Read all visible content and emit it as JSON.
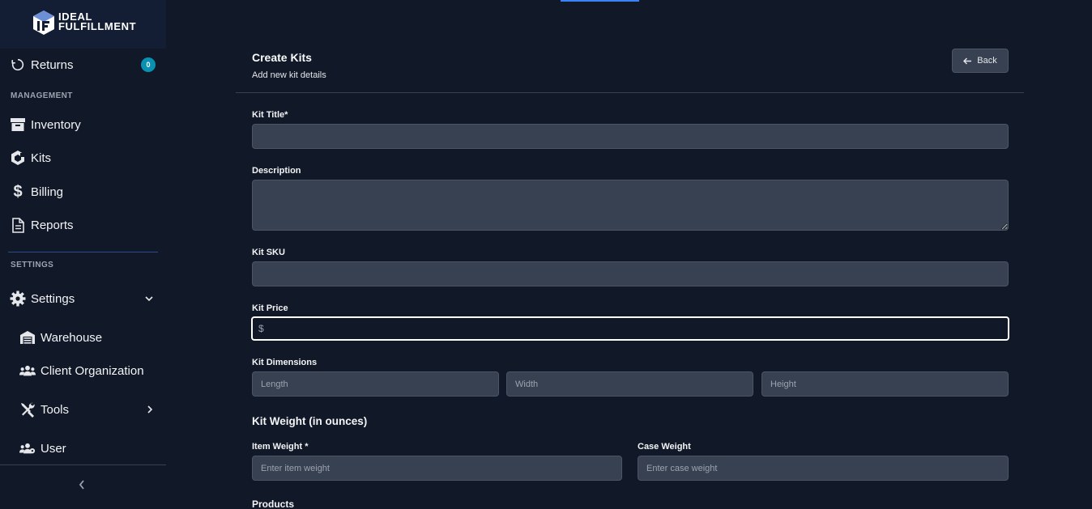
{
  "brand": {
    "logo_text": "IDEAL\nFULFILLMENT"
  },
  "sidebar": {
    "returns": {
      "label": "Returns",
      "badge": "0"
    },
    "management_label": "MANAGEMENT",
    "management_items": [
      {
        "label": "Inventory",
        "icon": "archive-icon"
      },
      {
        "label": "Kits",
        "icon": "cube-icon"
      },
      {
        "label": "Billing",
        "icon": "dollar-icon"
      },
      {
        "label": "Reports",
        "icon": "document-icon"
      }
    ],
    "settings_label": "SETTINGS",
    "settings": {
      "label": "Settings",
      "icon": "gear-icon"
    },
    "settings_items": [
      {
        "label": "Warehouse",
        "icon": "warehouse-icon"
      },
      {
        "label": "Client Organization",
        "icon": "users-icon"
      },
      {
        "label": "Tools",
        "icon": "tools-icon"
      },
      {
        "label": "User",
        "icon": "user-group-icon"
      }
    ]
  },
  "header": {
    "title": "Create Kits",
    "subtitle": "Add new kit details",
    "back_label": "Back"
  },
  "form": {
    "kit_title_label": "Kit Title*",
    "description_label": "Description",
    "kit_sku_label": "Kit SKU",
    "kit_price_label": "Kit Price",
    "price_prefix": "$",
    "dimensions_label": "Kit Dimensions",
    "length_placeholder": "Length",
    "width_placeholder": "Width",
    "height_placeholder": "Height",
    "weight_heading": "Kit Weight (in ounces)",
    "item_weight_label": "Item Weight *",
    "item_weight_placeholder": "Enter item weight",
    "case_weight_label": "Case Weight",
    "case_weight_placeholder": "Enter case weight",
    "products_label": "Products"
  },
  "colors": {
    "background": "#111827",
    "input": "#374151",
    "accent": "#0891b2",
    "active_line": "#3b82f6"
  }
}
